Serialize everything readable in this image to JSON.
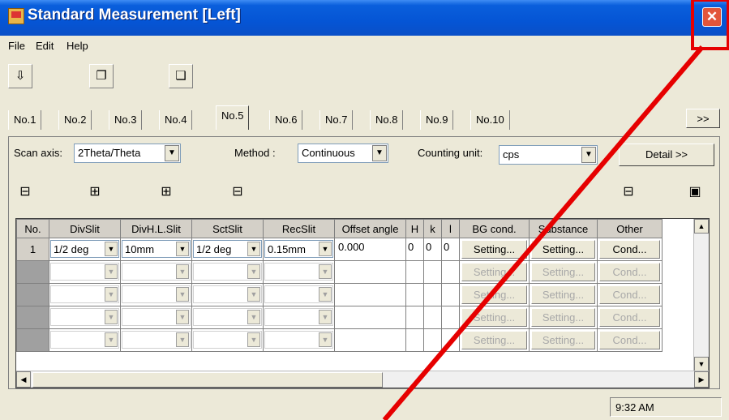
{
  "window": {
    "title": "Standard Measurement [Left]",
    "close_glyph": "✕"
  },
  "menu": [
    "File",
    "Edit",
    "Help"
  ],
  "toolbar": {
    "icons": [
      "import-icon",
      "copy-left-icon",
      "copy-right-icon"
    ]
  },
  "tabs": [
    "No.1",
    "No.2",
    "No.3",
    "No.4",
    "No.5",
    "No.6",
    "No.7",
    "No.8",
    "No.9",
    "No.10"
  ],
  "active_tab": "No.5",
  "tab_scroll": ">>",
  "scan": {
    "axis_label": "Scan axis:",
    "axis_value": "2Theta/Theta",
    "method_label": "Method  :",
    "method_value": "Continuous",
    "unit_label": "Counting unit:",
    "unit_value": "cps",
    "detail_button": "Detail >>"
  },
  "grid": {
    "columns": [
      "No.",
      "DivSlit",
      "DivH.L.Slit",
      "SctSlit",
      "RecSlit",
      "Offset angle",
      "H",
      "k",
      "l",
      "BG cond.",
      "Substance",
      "Other"
    ],
    "rows": [
      {
        "no": "1",
        "divslit": "1/2 deg",
        "divhl": "10mm",
        "sctslit": "1/2 deg",
        "recslit": "0.15mm",
        "offset": "0.000",
        "h": "0",
        "k": "0",
        "l": "0",
        "bg": "Setting...",
        "substance": "Setting...",
        "other": "Cond..."
      },
      {
        "no": "",
        "bg": "Setting...",
        "substance": "Setting...",
        "other": "Cond..."
      },
      {
        "no": "",
        "bg": "Setting...",
        "substance": "Setting...",
        "other": "Cond..."
      },
      {
        "no": "",
        "bg": "Setting...",
        "substance": "Setting...",
        "other": "Cond..."
      },
      {
        "no": "",
        "bg": "Setting...",
        "substance": "Setting...",
        "other": "Cond..."
      }
    ]
  },
  "status": {
    "time": "9:32 AM"
  },
  "accent": {
    "highlight": "#e60000",
    "titlebar": "#0555d5"
  }
}
